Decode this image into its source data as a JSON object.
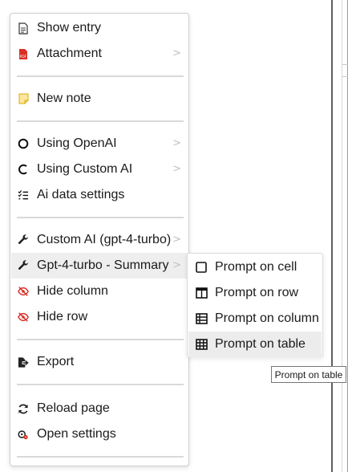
{
  "menu": {
    "items": [
      {
        "label": "Show entry",
        "icon": "document-icon"
      },
      {
        "label": "Attachment",
        "icon": "pdf-icon",
        "submenu": true
      },
      {
        "label": "New note",
        "icon": "note-icon"
      },
      {
        "label": "Using OpenAI",
        "icon": "circle-icon",
        "submenu": true
      },
      {
        "label": "Using Custom AI",
        "icon": "open-circle-icon",
        "submenu": true
      },
      {
        "label": "Ai data settings",
        "icon": "checklist-icon"
      },
      {
        "label": "Custom AI (gpt-4-turbo)",
        "icon": "wrench-icon",
        "submenu": true
      },
      {
        "label": "Gpt-4-turbo - Summary",
        "icon": "wrench-icon",
        "submenu": true
      },
      {
        "label": "Hide column",
        "icon": "eye-slash-icon"
      },
      {
        "label": "Hide row",
        "icon": "eye-slash-icon"
      },
      {
        "label": "Export",
        "icon": "export-icon"
      },
      {
        "label": "Reload page",
        "icon": "reload-icon"
      },
      {
        "label": "Open settings",
        "icon": "settings-icon"
      }
    ],
    "chevron": ">"
  },
  "submenu": {
    "items": [
      {
        "label": "Prompt on cell",
        "icon": "cell-icon"
      },
      {
        "label": "Prompt on row",
        "icon": "row-icon"
      },
      {
        "label": "Prompt on column",
        "icon": "column-icon"
      },
      {
        "label": "Prompt on table",
        "icon": "table-icon"
      }
    ]
  },
  "tooltip": "Prompt on table",
  "colors": {
    "pdf_red": "#d93025",
    "eye_red": "#d93025",
    "note_yellow": "#f5c542",
    "hover_bg": "#eeeeee"
  }
}
